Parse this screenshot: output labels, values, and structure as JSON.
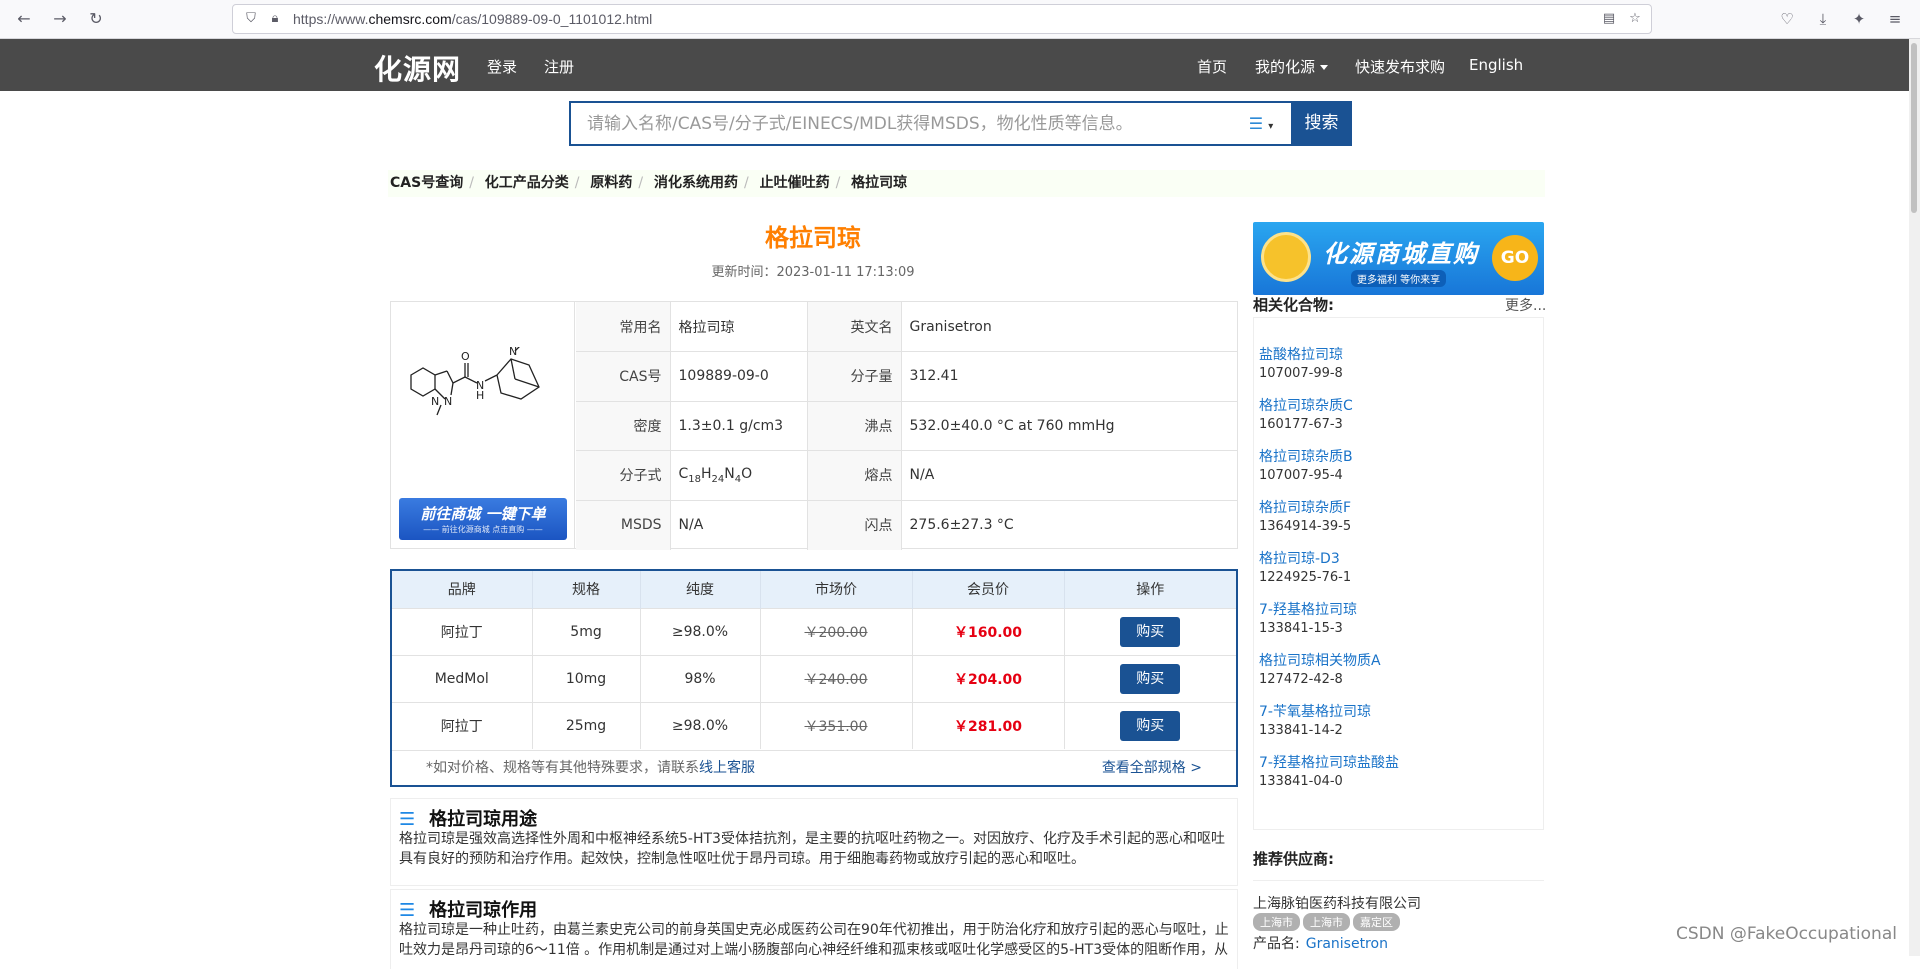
{
  "browser": {
    "url_prefix": "https://www.",
    "url_host": "chemsrc.com",
    "url_path": "/cas/109889-09-0_1101012.html"
  },
  "header": {
    "logo": "化源网",
    "login": "登录",
    "register": "注册",
    "home": "首页",
    "my": "我的化源",
    "quick_post": "快速发布求购",
    "english": "English"
  },
  "search": {
    "placeholder": "请输入名称/CAS号/分子式/EINECS/MDL获得MSDS，物化性质等信息。",
    "button": "搜索"
  },
  "breadcrumb": [
    "CAS号查询",
    "化工产品分类",
    "原料药",
    "消化系统用药",
    "止吐催吐药",
    "格拉司琼"
  ],
  "compound": {
    "title": "格拉司琼",
    "updated": "更新时间：2023-01-11 17:13:09",
    "shop_banner_main": "前往商城 一键下单",
    "shop_banner_sub": "—— 前往化源商城 点击直购 ——",
    "info": [
      {
        "k1": "常用名",
        "v1": "格拉司琼",
        "k2": "英文名",
        "v2": "Granisetron"
      },
      {
        "k1": "CAS号",
        "v1": "109889-09-0",
        "k2": "分子量",
        "v2": "312.41"
      },
      {
        "k1": "密度",
        "v1": "1.3±0.1 g/cm3",
        "k2": "沸点",
        "v2": "532.0±40.0 °C at 760 mmHg"
      },
      {
        "k1": "分子式",
        "v1": "",
        "k2": "熔点",
        "v2": "N/A"
      },
      {
        "k1": "MSDS",
        "v1": "N/A",
        "k2": "闪点",
        "v2": "275.6±27.3 °C"
      }
    ],
    "formula_parts": [
      "C",
      "18",
      "H",
      "24",
      "N",
      "4",
      "O"
    ]
  },
  "price": {
    "headers": [
      "品牌",
      "规格",
      "纯度",
      "市场价",
      "会员价",
      "操作"
    ],
    "rows": [
      {
        "brand": "阿拉丁",
        "spec": "5mg",
        "purity": "≥98.0%",
        "market": "￥200.00",
        "member": "￥160.00",
        "action": "购买"
      },
      {
        "brand": "MedMol",
        "spec": "10mg",
        "purity": "98%",
        "market": "￥240.00",
        "member": "￥204.00",
        "action": "购买"
      },
      {
        "brand": "阿拉丁",
        "spec": "25mg",
        "purity": "≥98.0%",
        "market": "￥351.00",
        "member": "￥281.00",
        "action": "购买"
      }
    ],
    "note": "*如对价格、规格等有其他特殊要求，请联系",
    "note_link": "线上客服",
    "view_all": "查看全部规格 >"
  },
  "sections": [
    {
      "title": "格拉司琼用途",
      "body": "格拉司琼是强效高选择性外周和中枢神经系统5-HT3受体拮抗剂，是主要的抗呕吐药物之一。对因放疗、化疗及手术引起的恶心和呕吐具有良好的预防和治疗作用。起效快，控制急性呕吐优于昂丹司琼。用于细胞毒药物或放疗引起的恶心和呕吐。"
    },
    {
      "title": "格拉司琼作用",
      "body": "格拉司琼是一种止吐药，由葛兰素史克公司的前身英国史克必成医药公司在90年代初推出，用于防治化疗和放疗引起的恶心与呕吐，止吐效力是昂丹司琼的6～11倍 。作用机制是通过对上端小肠腹部向心神经纤维和孤束核或呕吐化学感受区的5-HT3受体的阻断作用，从"
    }
  ],
  "sidebar": {
    "ad_title": "化源商城直购",
    "ad_sub": "更多福利 等你来享",
    "ad_go": "GO",
    "related_head": "相关化合物:",
    "related_more": "更多...",
    "related": [
      {
        "name": "盐酸格拉司琼",
        "cas": "107007-99-8"
      },
      {
        "name": "格拉司琼杂质C",
        "cas": "160177-67-3"
      },
      {
        "name": "格拉司琼杂质B",
        "cas": "107007-95-4"
      },
      {
        "name": "格拉司琼杂质F",
        "cas": "1364914-39-5"
      },
      {
        "name": "格拉司琼-D3",
        "cas": "1224925-76-1"
      },
      {
        "name": "7-羟基格拉司琼",
        "cas": "133841-15-3"
      },
      {
        "name": "格拉司琼相关物质A",
        "cas": "127472-42-8"
      },
      {
        "name": "7-苄氧基格拉司琼",
        "cas": "133841-14-2"
      },
      {
        "name": "7-羟基格拉司琼盐酸盐",
        "cas": "133841-04-0"
      }
    ],
    "supplier_head": "推荐供应商:",
    "supplier_name": "上海脉铂医药科技有限公司",
    "tags": [
      "上海市",
      "上海市",
      "嘉定区"
    ],
    "product_label": "产品名:",
    "product_name": "Granisetron"
  },
  "watermark": "CSDN @FakeOccupational"
}
